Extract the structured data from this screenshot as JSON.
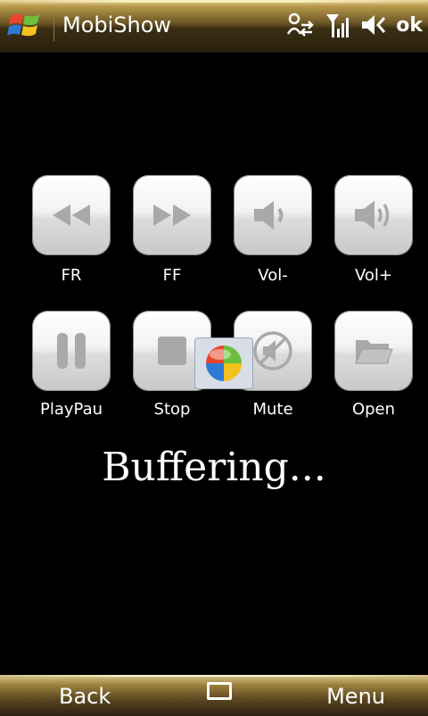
{
  "window": {
    "app_title": "MobiShow",
    "ok_label": "ok"
  },
  "controls": [
    {
      "label": "FR",
      "icon": "rewind-icon"
    },
    {
      "label": "FF",
      "icon": "fast-forward-icon"
    },
    {
      "label": "Vol-",
      "icon": "volume-down-icon"
    },
    {
      "label": "Vol+",
      "icon": "volume-up-icon"
    },
    {
      "label": "PlayPau",
      "icon": "pause-icon"
    },
    {
      "label": "Stop",
      "icon": "stop-icon"
    },
    {
      "label": "Mute",
      "icon": "mute-icon"
    },
    {
      "label": "Open",
      "icon": "folder-icon"
    }
  ],
  "status": {
    "text": "Buffering..."
  },
  "softkeys": {
    "left": "Back",
    "right": "Menu"
  },
  "colors": {
    "icon_glyph": "#a9a9a9",
    "title_bar": "#6a5424"
  }
}
